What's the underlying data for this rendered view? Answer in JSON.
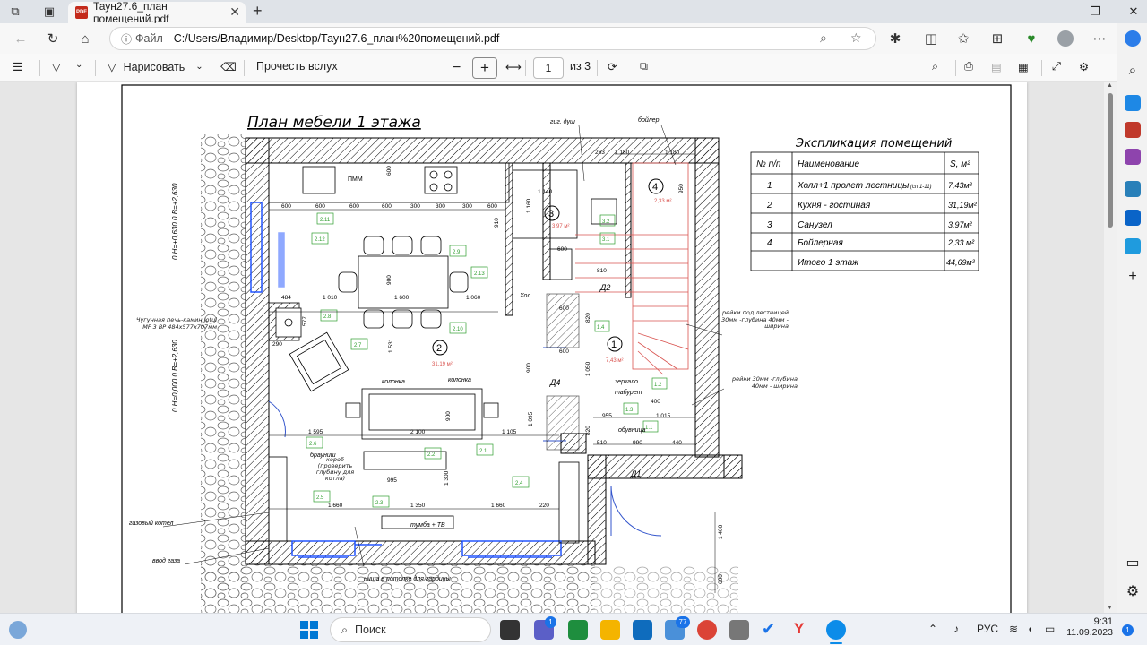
{
  "browser": {
    "tab_title": "Таун27.6_план помещений.pdf",
    "address_scheme": "Файл",
    "address_url": "C:/Users/Владимир/Desktop/Таун27.6_план%20помещений.pdf"
  },
  "pdf_toolbar": {
    "draw_label": "Нарисовать",
    "read_aloud_label": "Прочесть вслух",
    "page_current": "1",
    "page_total": "из 3"
  },
  "drawing": {
    "title": "План мебели 1 этажа",
    "explication_title": "Экспликация помещений",
    "table_headers": [
      "№ п/п",
      "Наименование",
      "S, м²"
    ],
    "rows": [
      {
        "num": "1",
        "name": "Холл+1 пролет лестницы",
        "note": "(сп 1-11)",
        "area": "7,43м²"
      },
      {
        "num": "2",
        "name": "Кухня - гостиная",
        "note": "",
        "area": "31,19м²"
      },
      {
        "num": "3",
        "name": "Санузел",
        "note": "",
        "area": "3,97м²"
      },
      {
        "num": "4",
        "name": "Бойлерная",
        "note": "",
        "area": "2,33 м²"
      }
    ],
    "total_label": "Итого 1 этаж",
    "total_area": "44,69м²",
    "labels": {
      "gig_dush": "гиг. душ",
      "boiler": "бойлер",
      "stove": "Чугунная печь-камин Jotul MF 3 BP 484x577x707мм",
      "level_top": "0.Н=+0,630 0.В=+2,630",
      "level_mid": "0.Н=0,000 0.В=+2,630",
      "column1": "колонка",
      "column2": "колонка",
      "hall": "Хол",
      "rails_stair": "рейки под лестницей 30мм -глубина 40мм - ширина",
      "rails": "рейки 30мм -глубина 40мм - ширина",
      "mirror": "зеркало",
      "stool": "табурет",
      "shoe": "обувница",
      "brownie": "брауниш",
      "box": "короб (проверить глубину для котла)",
      "gas_boiler": "газовый котел",
      "gas_in": "ввод газа",
      "niche": "ниша в потолке для гардины",
      "tumba": "тумба + ТВ",
      "pmm": "ПММ",
      "room2_area": "31,19 м²",
      "room3_area": "3,97 м²",
      "room4_area": "2,33 м²",
      "room1_area": "7,43 м²",
      "d1": "Д1",
      "d2": "Д2",
      "d4": "Д4"
    },
    "dims": {
      "d600": "600",
      "d300": "300",
      "d1060": "1 060",
      "d1010": "1 010",
      "d1600": "1 600",
      "d484": "484",
      "d1595": "1 595",
      "d2100": "2 100",
      "d1105": "1 105",
      "d995": "995",
      "d1350": "1 350",
      "d1660": "1 660",
      "d220": "220",
      "d955": "955",
      "d1015": "1 015",
      "d510": "510",
      "d990": "990",
      "d440": "440",
      "d400": "400",
      "d810": "810",
      "d1140": "1 140",
      "d1400": "1 400",
      "d577": "577",
      "d290": "290",
      "d900": "900",
      "d1531": "1 531",
      "d1300": "1 300",
      "d1095": "1 095",
      "d910": "910",
      "d1160": "1 160",
      "d820": "820",
      "d1050": "1 050",
      "d263": "263",
      "d950": "950",
      "d1180": "1 180"
    },
    "furniture_tags": [
      "2.11",
      "2.12",
      "2.9",
      "2.13",
      "2.8",
      "2.7",
      "2.10",
      "2.6",
      "2.5",
      "2.2",
      "2.1",
      "2.4",
      "2.3",
      "3.2",
      "3.1",
      "1.4",
      "1.2",
      "1.3",
      "1.1"
    ]
  },
  "taskbar": {
    "search_label": "Поиск",
    "lang": "РУС",
    "time": "9:31",
    "date": "11.09.2023",
    "badge_chat": "1",
    "badge_store": "77",
    "notif_count": "1"
  },
  "colors": {
    "wall_hatch": "#000000",
    "dim_red": "#d9534f",
    "tag_green": "#2e9e2e",
    "door_blue": "#3355cc",
    "win_blue": "#2255ff"
  }
}
